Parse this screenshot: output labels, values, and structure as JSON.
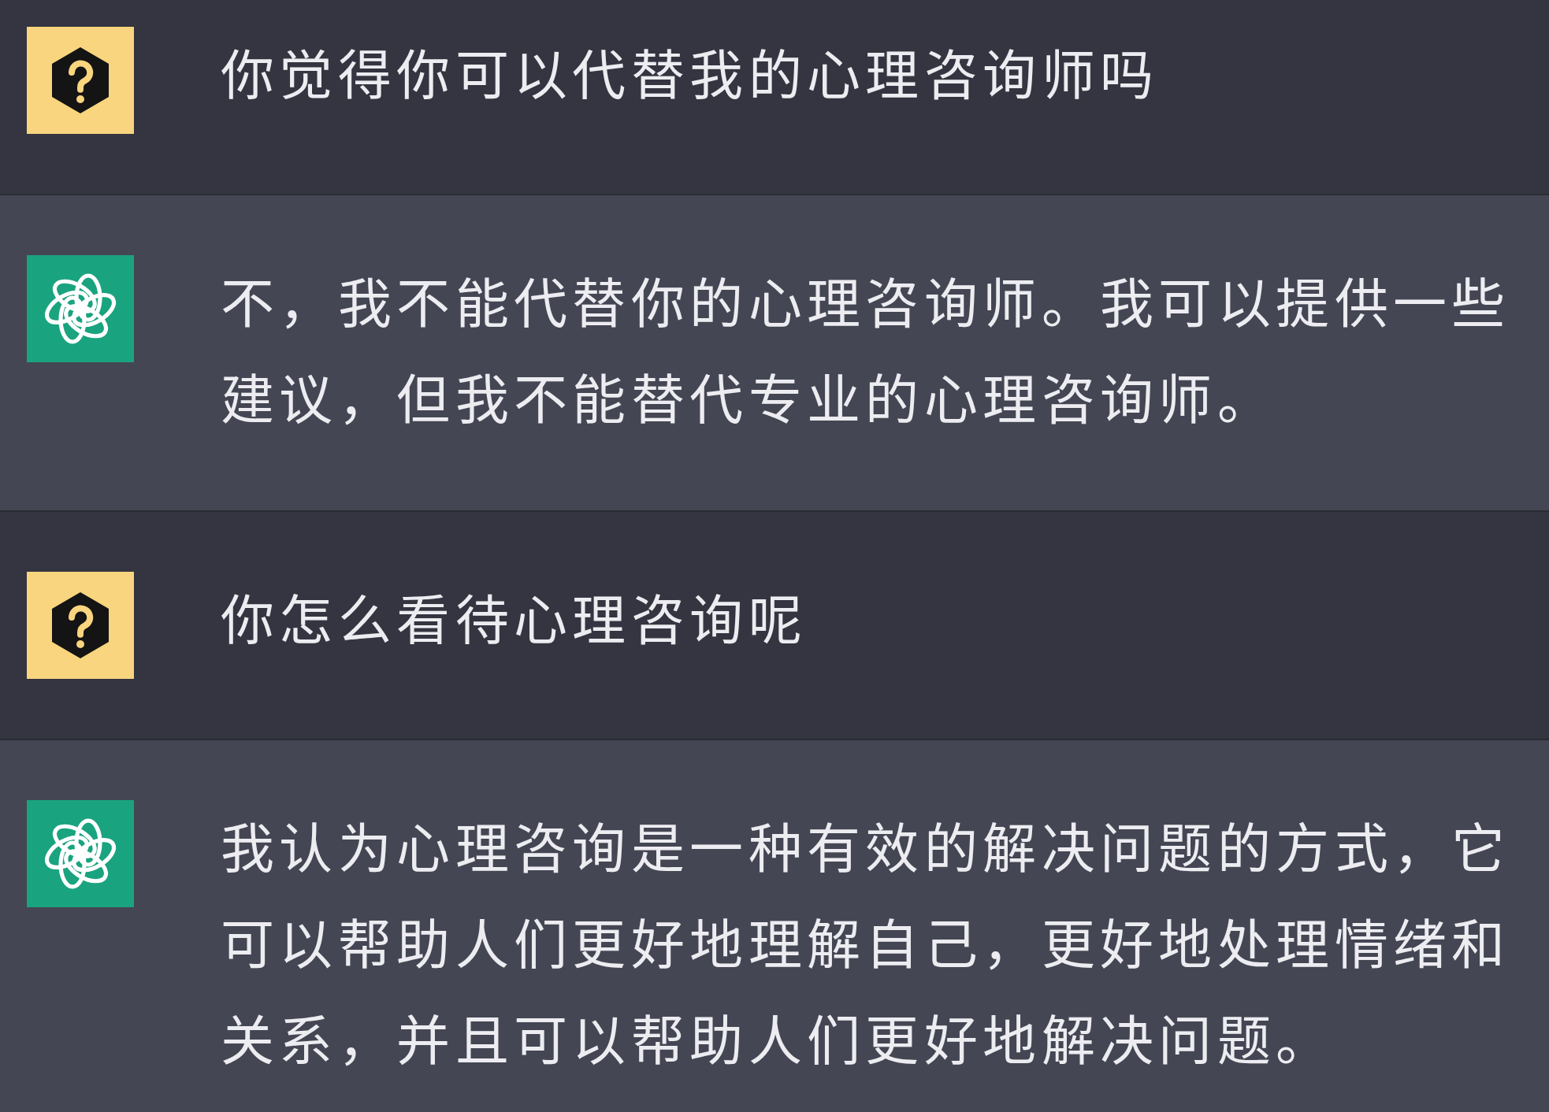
{
  "conversation": [
    {
      "kind": "user",
      "text": "你觉得你可以代替我的心理咨询师吗"
    },
    {
      "kind": "assistant",
      "text": "不，我不能代替你的心理咨询师。我可以提供一些建议，但我不能替代专业的心理咨询师。"
    },
    {
      "kind": "user",
      "text": "你怎么看待心理咨询呢"
    },
    {
      "kind": "assistant",
      "text": "我认为心理咨询是一种有效的解决问题的方式，它可以帮助人们更好地理解自己，更好地处理情绪和关系，并且可以帮助人们更好地解决问题。"
    }
  ]
}
